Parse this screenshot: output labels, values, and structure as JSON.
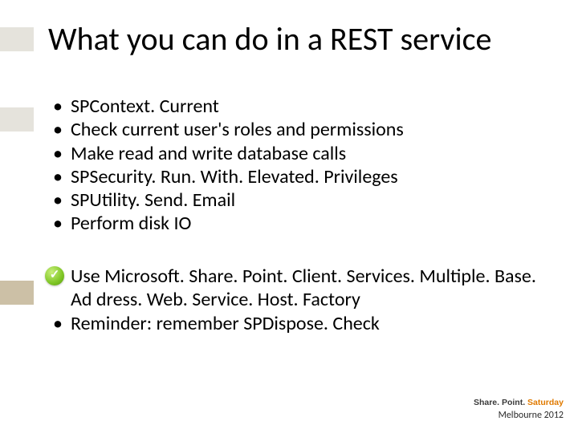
{
  "title": "What you can do in a REST service",
  "bullets": {
    "b0": "SPContext. Current",
    "b1": "Check current user's roles and permissions",
    "b2": "Make read and write database calls",
    "b3": "SPSecurity. Run. With. Elevated. Privileges",
    "b4": "SPUtility. Send. Email",
    "b5": "Perform disk IO"
  },
  "notes": {
    "use_line": "Use Microsoft. Share. Point. Client. Services. Multiple. Base. Ad dress. Web. Service. Host. Factory",
    "reminder": "Reminder: remember SPDispose. Check"
  },
  "footer": {
    "brand1": "Share. Point.",
    "brand2": " Saturday",
    "location": "Melbourne 2012"
  }
}
